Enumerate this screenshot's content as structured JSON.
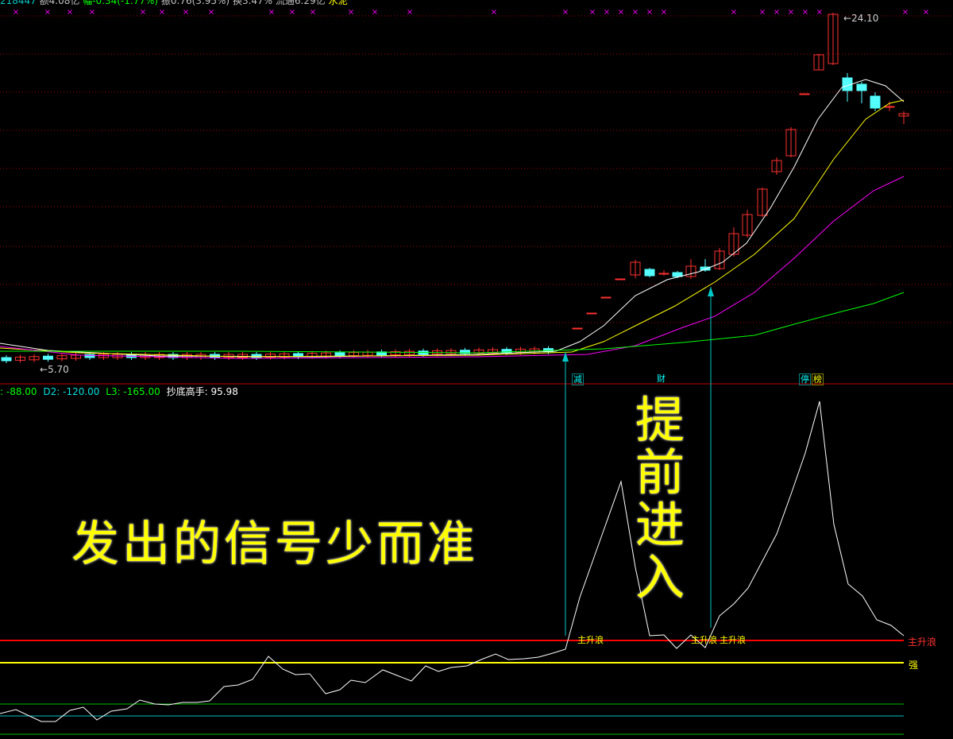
{
  "header": {
    "vol_fragment": "218447",
    "amount": "额4.08亿",
    "change": "幅-0.34(-1.77%)",
    "amplitude": "振0.76(3.95%)",
    "turnover": "换3.47%",
    "float_cap": "流通6.29亿",
    "sector": "水泥"
  },
  "price_labels": {
    "high": "24.10",
    "low": "5.70"
  },
  "indicator_header": {
    "l1": ": -88.00",
    "d2": "D2: -120.00",
    "l3": "L3: -165.00",
    "name": "抄底高手:",
    "value": "95.98"
  },
  "badges": [
    {
      "text": "减",
      "color": "#00ffff"
    },
    {
      "text": "财",
      "color": "#00ffff"
    },
    {
      "text": "停",
      "color": "#00ffff"
    },
    {
      "text": "榜",
      "color": "#ffff00"
    }
  ],
  "signals": [
    "主升浪",
    "主升浪",
    "主升浪"
  ],
  "levels": {
    "main_wave": "主升浪",
    "strong": "强"
  },
  "captions": {
    "left": "发出的信号少而准",
    "right_chars": [
      "提",
      "前",
      "进",
      "入"
    ]
  },
  "colors": {
    "up": "#ff3030",
    "down": "#54ffff",
    "ma5": "#ffffff",
    "ma10": "#ffff00",
    "ma20": "#ff00ff",
    "ma60": "#00ff00",
    "grid": "#a00000",
    "level_red": "#ff0000",
    "level_yellow": "#ffff00",
    "level_green": "#00c000",
    "level_cyan": "#00c0c0",
    "arrow": "#00c8c8",
    "marker": "#ff00ff"
  }
}
